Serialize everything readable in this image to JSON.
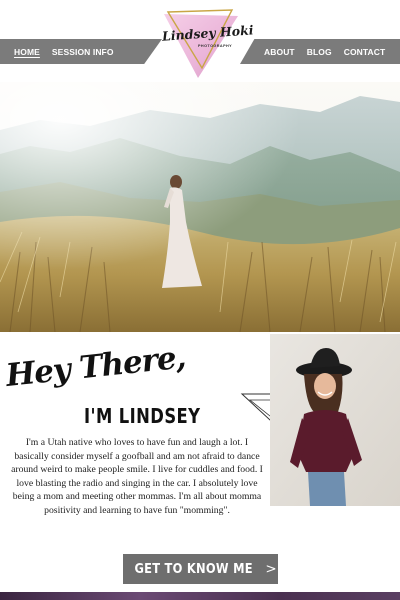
{
  "nav": {
    "left_links": [
      "HOME",
      "SESSION INFO"
    ],
    "right_links": [
      "ABOUT",
      "BLOG",
      "CONTACT"
    ],
    "active": "HOME"
  },
  "logo": {
    "name": "Lindsey Hoki",
    "tagline": "PHOTOGRAPHY"
  },
  "hero": {
    "image": "maternity-photo-mountain-field"
  },
  "about": {
    "greeting": "Hey There,",
    "name_heading": "I'M LINDSEY",
    "bio": "I'm a Utah native who loves to have fun and laugh a lot. I basically consider myself a goofball and am not afraid to dance around weird to make people smile. I live for cuddles and food. I love blasting the radio and singing in the car. I absolutely love being a mom and meeting other mommas. I'm all about momma positivity and learning to have fun \"momming\".",
    "cta_label": "GET TO KNOW ME",
    "cta_arrow": ">",
    "portrait": "photographer-portrait"
  },
  "colors": {
    "nav_gray": "#7b7b7b",
    "button_gray": "#6e6e6e",
    "logo_pink": "#e7a7d2",
    "logo_gold": "#c9a646",
    "footer_purple": "#5a3f62"
  }
}
